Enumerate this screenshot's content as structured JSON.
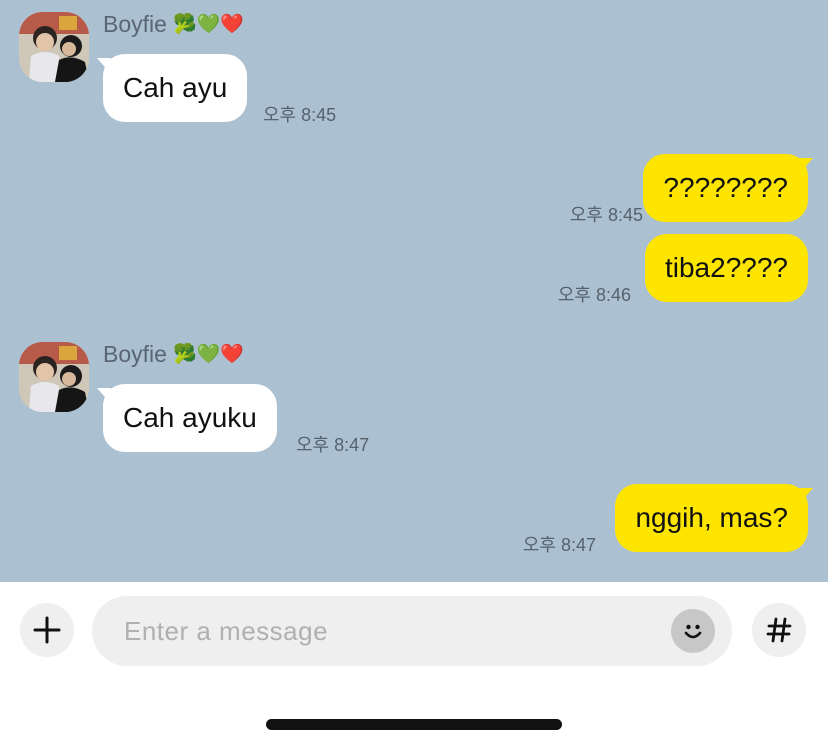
{
  "theme": {
    "chat_bg": "#abc1d1",
    "bubble_out": "#fee500",
    "bubble_in": "#ffffff"
  },
  "messages": [
    {
      "direction": "incoming",
      "sender": "Boyfie",
      "sender_emojis": "🥦💚❤️",
      "text": "Cah ayu",
      "time": "오후 8:45"
    },
    {
      "direction": "outgoing",
      "text": "????????",
      "time": "오후 8:45"
    },
    {
      "direction": "outgoing",
      "text": "tiba2????",
      "time": "오후 8:46"
    },
    {
      "direction": "incoming",
      "sender": "Boyfie",
      "sender_emojis": "🥦💚❤️",
      "text": "Cah ayuku",
      "time": "오후 8:47"
    },
    {
      "direction": "outgoing",
      "text": "nggih, mas?",
      "time": "오후 8:47"
    }
  ],
  "composer": {
    "placeholder": "Enter a message",
    "add_icon": "plus-icon",
    "emoji_icon": "smiley-icon",
    "hashtag_icon": "hashtag-icon"
  }
}
